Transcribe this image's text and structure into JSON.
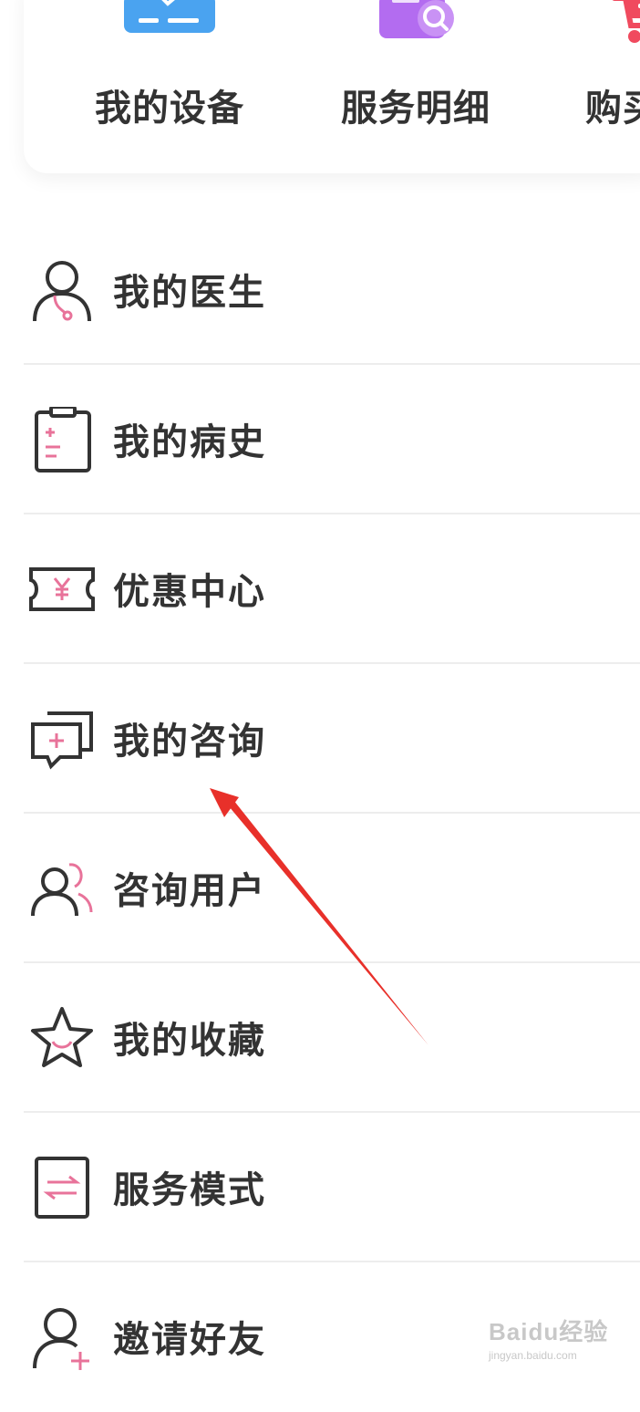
{
  "quick_actions": [
    {
      "label": "我的设备",
      "icon": "tablet-device-icon"
    },
    {
      "label": "服务明细",
      "icon": "document-search-icon"
    },
    {
      "label": "购买",
      "icon": "shopping-cart-icon"
    }
  ],
  "menu": {
    "items": [
      {
        "label": "我的医生",
        "icon": "doctor-icon"
      },
      {
        "label": "我的病史",
        "icon": "clipboard-icon"
      },
      {
        "label": "优惠中心",
        "icon": "coupon-ticket-icon"
      },
      {
        "label": "我的咨询",
        "icon": "consult-chat-icon"
      },
      {
        "label": "咨询用户",
        "icon": "users-icon"
      },
      {
        "label": "我的收藏",
        "icon": "star-icon"
      },
      {
        "label": "服务模式",
        "icon": "switch-mode-icon"
      },
      {
        "label": "邀请好友",
        "icon": "add-friend-icon"
      }
    ]
  },
  "watermark": {
    "brand": "Baidu经验",
    "url": "jingyan.baidu.com"
  },
  "colors": {
    "text": "#333333",
    "accent_pink": "#e8739a",
    "device_blue": "#4aa3f0",
    "service_purple": "#b36cf0",
    "cart_red": "#f04a5e",
    "annotation_arrow": "#e8302a",
    "divider": "#ededed"
  }
}
